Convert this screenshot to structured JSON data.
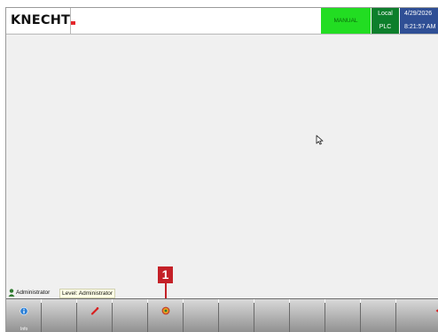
{
  "header": {
    "logo_text": "KNECHT",
    "mode_label": "MANUAL",
    "location_line1": "Local",
    "location_line2": "PLC",
    "date": "4/29/2026",
    "time": "8:21:57 AM"
  },
  "status_bar": {
    "user_name": "Administrator",
    "level_text": "Level: Administrator"
  },
  "callout": {
    "number": "1"
  },
  "toolbar": {
    "buttons": [
      {
        "icon": "info-icon",
        "label": "Info"
      },
      {
        "icon": "",
        "label": ""
      },
      {
        "icon": "wrench-icon",
        "label": ""
      },
      {
        "icon": "",
        "label": ""
      },
      {
        "icon": "settings-icon",
        "label": ""
      },
      {
        "icon": "",
        "label": ""
      },
      {
        "icon": "",
        "label": ""
      },
      {
        "icon": "",
        "label": ""
      },
      {
        "icon": "",
        "label": ""
      },
      {
        "icon": "",
        "label": ""
      },
      {
        "icon": "",
        "label": ""
      },
      {
        "icon": "exit-icon",
        "label": ""
      }
    ]
  },
  "colors": {
    "mode_bg": "#22dd22",
    "location_bg": "#0d7f2c",
    "datetime_bg": "#2f4f95",
    "accent_red": "#e4262b",
    "callout_red": "#c42027"
  }
}
